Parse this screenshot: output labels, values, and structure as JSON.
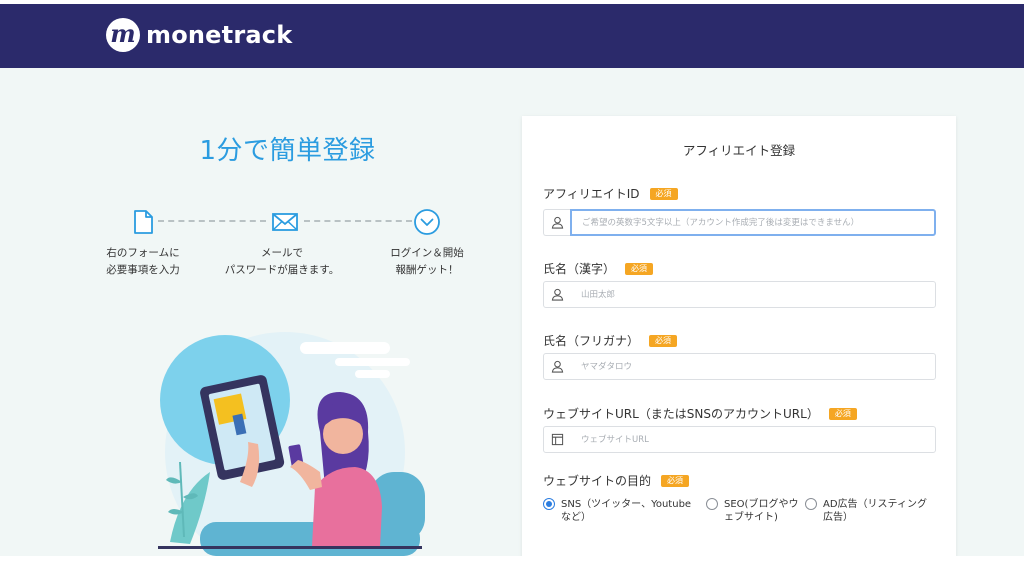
{
  "brand": {
    "name": "monetrack",
    "mark": "m",
    "tm": "™"
  },
  "colors": {
    "header_bg": "#2b2a6b",
    "accent_blue": "#2b9ce0",
    "required_badge": "#f5a623",
    "focus_border": "#7fb0ee"
  },
  "hero": {
    "headline": "1分で簡単登録"
  },
  "steps": [
    {
      "icon": "document-icon",
      "label": "右のフォームに\n必要事項を入力"
    },
    {
      "icon": "envelope-icon",
      "label": "メールで\nパスワードが届きます。"
    },
    {
      "icon": "chevron-circle-icon",
      "label": "ログイン＆開始\n報酬ゲット！"
    }
  ],
  "form": {
    "title": "アフィリエイト登録",
    "required_label": "必須",
    "fields": [
      {
        "label": "アフィリエイトID",
        "icon": "user-icon",
        "value": "",
        "placeholder": "ご希望の英数字5文字以上（アカウント作成完了後は変更はできません）"
      },
      {
        "label": "氏名（漢字）",
        "icon": "user-icon",
        "value": "",
        "placeholder": "山田太郎"
      },
      {
        "label": "氏名（フリガナ）",
        "icon": "user-icon",
        "value": "",
        "placeholder": "ヤマダタロウ"
      },
      {
        "label": "ウェブサイトURL（またはSNSのアカウントURL）",
        "icon": "layout-icon",
        "value": "",
        "placeholder": "ウェブサイトURL"
      }
    ],
    "purpose": {
      "label": "ウェブサイトの目的",
      "options": [
        {
          "line1": "SNS（ツイッター、Youtube",
          "line2": "など）",
          "checked": true
        },
        {
          "line1": "SEO(ブログやウ",
          "line2": "ェブサイト)",
          "checked": false
        },
        {
          "line1": "AD広告（リスティング",
          "line2": "広告）",
          "checked": false
        }
      ]
    }
  }
}
